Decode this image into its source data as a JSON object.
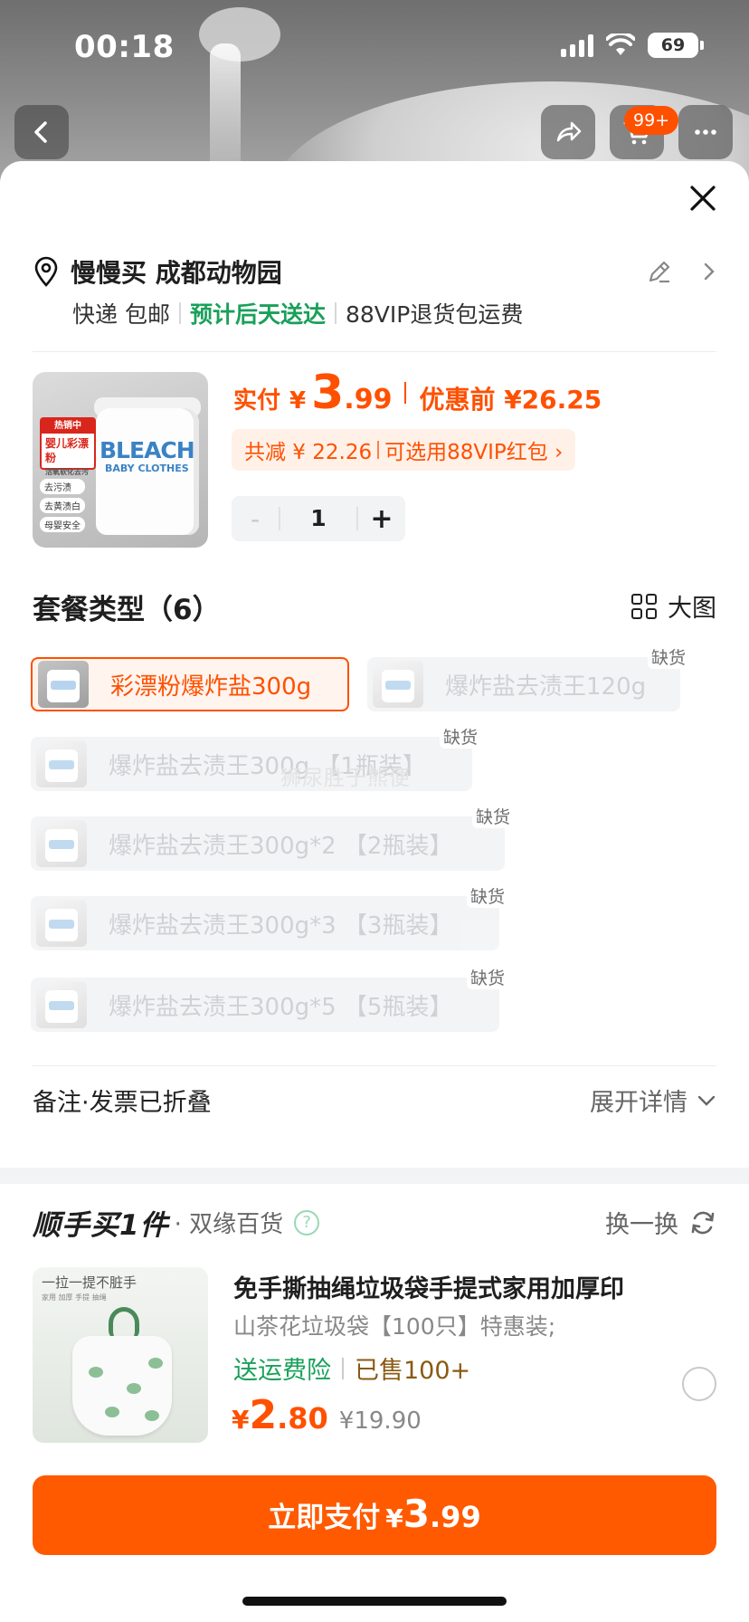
{
  "status_bar": {
    "time": "00:18",
    "battery": "69"
  },
  "nav": {
    "cart_badge": "99+"
  },
  "address": {
    "text": "慢慢买 成都动物园",
    "delivery_method": "快递 包邮",
    "eta": "预计后天送达",
    "return_policy": "88VIP退货包运费"
  },
  "product": {
    "image_texts": {
      "hot_head": "热销中",
      "hot_title": "婴儿彩漂粉",
      "hot_sub": "活氧软化去污",
      "brand_word": "BLEACH",
      "brand_sub": "BABY CLOTHES",
      "features": [
        "去污渍",
        "去黄渍白",
        "母婴安全"
      ]
    },
    "price_label": "实付",
    "currency": "¥",
    "price_int": "3",
    "price_dec": ".99",
    "price_before": "优惠前 ¥26.25",
    "discount_total": "共减 ¥ 22.26",
    "discount_hint": "可选用88VIP红包 ›",
    "quantity": "1",
    "minus": "-",
    "plus": "+"
  },
  "packages": {
    "title": "套餐类型（6）",
    "big_view_label": "大图",
    "options": [
      {
        "label": "彩漂粉爆炸盐300g",
        "selected": true,
        "out_of_stock": false
      },
      {
        "label": "爆炸盐去渍王120g",
        "selected": false,
        "out_of_stock": true
      },
      {
        "label": "爆炸盐去渍王300g 【1瓶装】",
        "selected": false,
        "out_of_stock": true
      },
      {
        "label": "爆炸盐去渍王300g*2 【2瓶装】",
        "selected": false,
        "out_of_stock": true
      },
      {
        "label": "爆炸盐去渍王300g*3 【3瓶装】",
        "selected": false,
        "out_of_stock": true
      },
      {
        "label": "爆炸盐去渍王300g*5 【5瓶装】",
        "selected": false,
        "out_of_stock": true
      }
    ],
    "oos_label": "缺货",
    "watermark": "狮尿胜于熊便"
  },
  "remark": {
    "title": "备注·发票已折叠",
    "expand_label": "展开详情"
  },
  "upsell": {
    "brand": "顺手买1件",
    "store": "· 双缘百货",
    "help": "?",
    "swap_label": "换一换",
    "image_caption": "一拉一提不脏手",
    "image_sub": "家用 加厚 手提 抽绳",
    "title": "免手撕抽绳垃圾袋手提式家用加厚印",
    "desc": "山茶花垃圾袋【100只】特惠装;",
    "insurance": "送运费险",
    "sold": "已售100+",
    "currency": "¥",
    "price_int": "2",
    "price_dec": ".80",
    "orig_price": "¥19.90"
  },
  "pay": {
    "label": "立即支付",
    "currency": "¥",
    "price_int": "3",
    "price_dec": ".99"
  },
  "colors": {
    "accent": "#ff5000",
    "green": "#19a05a",
    "pay_button": "#ff5a00"
  }
}
